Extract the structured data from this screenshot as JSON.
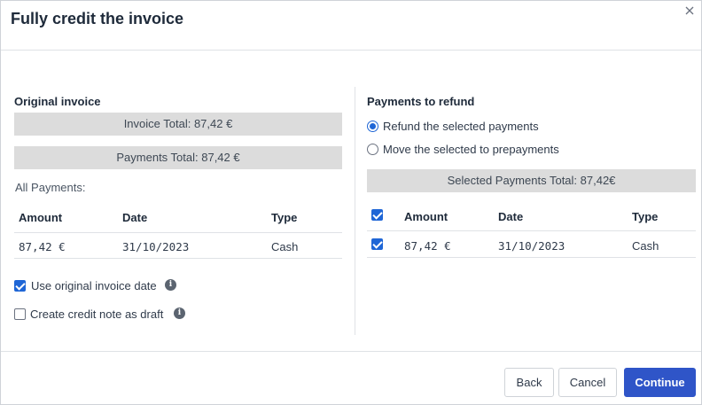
{
  "dialog": {
    "title": "Fully credit the invoice"
  },
  "original_invoice": {
    "section_title": "Original invoice",
    "invoice_total": "Invoice Total: 87,42 €",
    "payments_total": "Payments Total: 87,42 €",
    "all_payments_label": "All Payments:",
    "table": {
      "headers": [
        "Amount",
        "Date",
        "Type"
      ],
      "rows": [
        {
          "amount": "87,42 €",
          "date": "31/10/2023",
          "type": "Cash"
        }
      ]
    },
    "options": {
      "use_original_date": {
        "label": "Use original invoice date",
        "checked": true
      },
      "credit_note_draft": {
        "label": "Create credit note as draft",
        "checked": false
      }
    }
  },
  "payments_to_refund": {
    "section_title": "Payments to refund",
    "radio_options": [
      {
        "label": "Refund the selected payments",
        "selected": true
      },
      {
        "label": "Move the selected to prepayments",
        "selected": false
      }
    ],
    "selected_total": "Selected Payments Total: 87,42€",
    "table": {
      "headers": [
        "Amount",
        "Date",
        "Type"
      ],
      "rows": [
        {
          "amount": "87,42 €",
          "date": "31/10/2023",
          "type": "Cash",
          "checked": true
        }
      ]
    }
  },
  "footer": {
    "back_label": "Back",
    "cancel_label": "Cancel",
    "continue_label": "Continue"
  },
  "colors": {
    "primary_button": "#2f55c8",
    "checkbox_accent": "#1f66d6",
    "summary_bar": "#dcdcdc"
  }
}
